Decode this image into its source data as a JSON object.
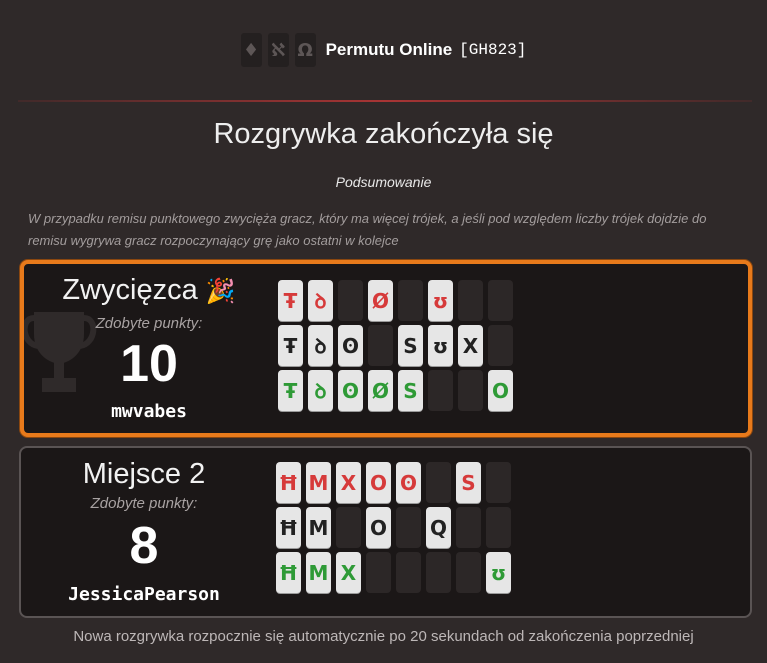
{
  "header": {
    "logo_glyphs": [
      "♦",
      "ℵ",
      "Ω"
    ],
    "brand": "Permutu Online",
    "code": "[GH823]"
  },
  "title": "Rozgrywka zakończyła się",
  "subtitle": "Podsumowanie",
  "note": "W przypadku remisu punktowego zwycięża gracz, który ma więcej trójek, a jeśli pod względem liczby trójek dojdzie do remisu wygrywa gracz rozpoczynający grę jako ostatni w kolejce",
  "colors": {
    "accent": "#e87a1b",
    "tile_red": "#d63a3a",
    "tile_black": "#222222",
    "tile_green": "#2e9a36",
    "background": "#2f2929",
    "card": "#1b1717"
  },
  "results": [
    {
      "title": "Zwycięzca",
      "emoji": "🎉",
      "points_label": "Zdobyte punkty:",
      "points": "10",
      "player": "mwvabes",
      "grid": [
        [
          {
            "g": "Ŧ",
            "c": "red"
          },
          {
            "g": "ꝺ",
            "c": "red"
          },
          null,
          {
            "g": "Ø",
            "c": "red"
          },
          null,
          {
            "g": "ʊ",
            "c": "red"
          },
          null,
          null
        ],
        [
          {
            "g": "Ŧ",
            "c": "black"
          },
          {
            "g": "ꝺ",
            "c": "black"
          },
          {
            "g": "ʘ",
            "c": "black"
          },
          null,
          {
            "g": "S",
            "c": "black"
          },
          {
            "g": "ʊ",
            "c": "black"
          },
          {
            "g": "X",
            "c": "black"
          },
          null
        ],
        [
          {
            "g": "Ŧ",
            "c": "green"
          },
          {
            "g": "ꝺ",
            "c": "green"
          },
          {
            "g": "ʘ",
            "c": "green"
          },
          {
            "g": "Ø",
            "c": "green"
          },
          {
            "g": "S",
            "c": "green"
          },
          null,
          null,
          {
            "g": "O",
            "c": "green"
          }
        ]
      ]
    },
    {
      "title": "Miejsce 2",
      "emoji": "",
      "points_label": "Zdobyte punkty:",
      "points": "8",
      "player": "JessicaPearson",
      "grid": [
        [
          {
            "g": "Ħ",
            "c": "red"
          },
          {
            "g": "M",
            "c": "red"
          },
          {
            "g": "X",
            "c": "red"
          },
          {
            "g": "O",
            "c": "red"
          },
          {
            "g": "ʘ",
            "c": "red"
          },
          null,
          {
            "g": "S",
            "c": "red"
          },
          null
        ],
        [
          {
            "g": "Ħ",
            "c": "black"
          },
          {
            "g": "M",
            "c": "black"
          },
          null,
          {
            "g": "O",
            "c": "black"
          },
          null,
          {
            "g": "Q",
            "c": "black"
          },
          null,
          null
        ],
        [
          {
            "g": "Ħ",
            "c": "green"
          },
          {
            "g": "M",
            "c": "green"
          },
          {
            "g": "X",
            "c": "green"
          },
          null,
          null,
          null,
          null,
          {
            "g": "ʊ",
            "c": "green"
          }
        ]
      ]
    }
  ],
  "footer": "Nowa rozgrywka rozpocznie się automatycznie po 20 sekundach od zakończenia poprzedniej"
}
